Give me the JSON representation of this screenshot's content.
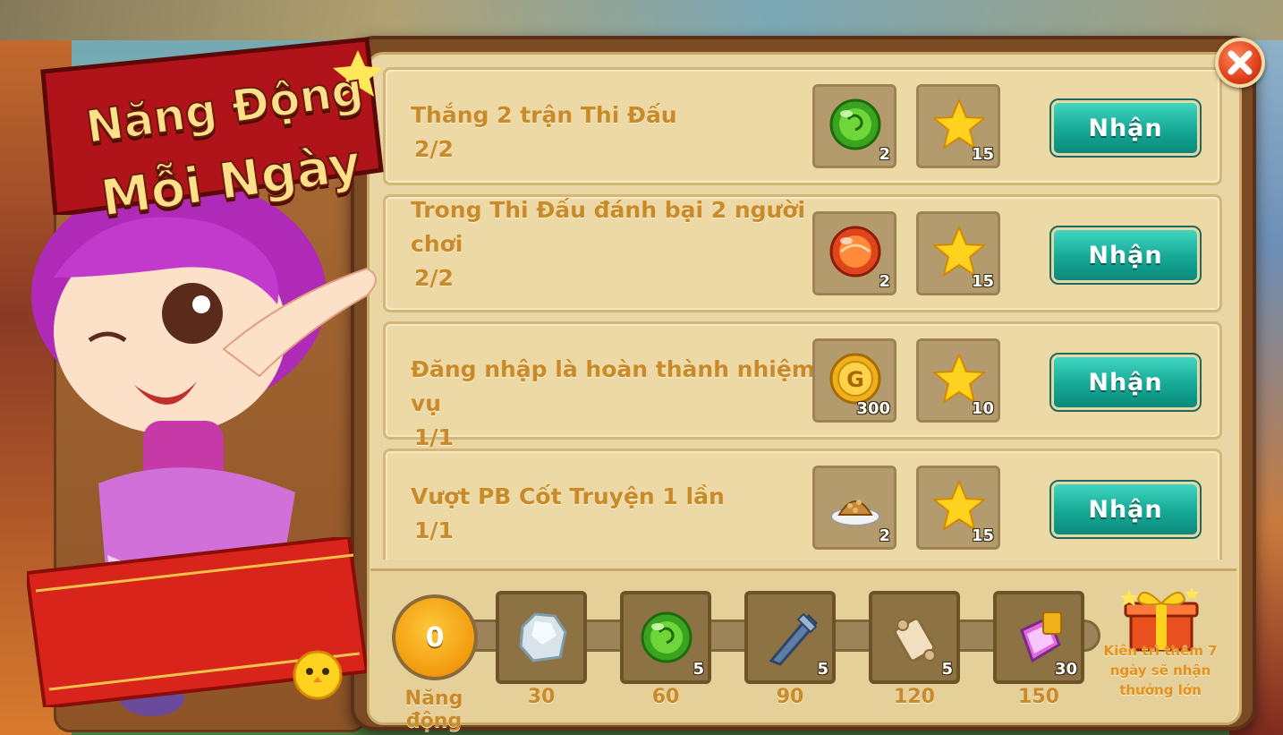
{
  "title": {
    "line1": "Năng Động",
    "line2": "Mỗi Ngày"
  },
  "tasks": [
    {
      "text": "Thắng 2 trận Thi Đấu",
      "progress": "2/2",
      "rewards": [
        {
          "icon": "green-orb-icon",
          "count": "2"
        },
        {
          "icon": "star-icon",
          "count": "15"
        }
      ],
      "button": "Nhận"
    },
    {
      "text": "Trong Thi Đấu đánh bại 2 người chơi",
      "progress": "2/2",
      "rewards": [
        {
          "icon": "red-orb-icon",
          "count": "2"
        },
        {
          "icon": "star-icon",
          "count": "15"
        }
      ],
      "button": "Nhận"
    },
    {
      "text": "Đăng nhập là hoàn thành nhiệm vụ",
      "progress": "1/1",
      "rewards": [
        {
          "icon": "gold-coin-icon",
          "count": "300"
        },
        {
          "icon": "star-icon",
          "count": "10"
        }
      ],
      "button": "Nhận"
    },
    {
      "text": "Vượt PB Cốt Truyện 1 lần",
      "progress": "1/1",
      "rewards": [
        {
          "icon": "food-plate-icon",
          "count": "2"
        },
        {
          "icon": "star-icon",
          "count": "15"
        }
      ],
      "button": "Nhận"
    }
  ],
  "energy": {
    "value": "0",
    "label": "Năng động"
  },
  "milestones": [
    {
      "icon": "ore-rock-icon",
      "count": "",
      "threshold": "30"
    },
    {
      "icon": "green-orb-icon",
      "count": "5",
      "threshold": "60"
    },
    {
      "icon": "drill-cone-icon",
      "count": "5",
      "threshold": "90"
    },
    {
      "icon": "scroll-icon",
      "count": "5",
      "threshold": "120"
    },
    {
      "icon": "crystal-box-icon",
      "count": "30",
      "threshold": "150"
    }
  ],
  "bonus": {
    "text": "Kiên trì thêm 7 ngày sẽ nhận thưởng lớn",
    "icon": "gift-box-icon"
  },
  "colors": {
    "button": "#16a896",
    "task_text": "#c98a2a",
    "panel": "#e9d6a4",
    "energy": "#f29b0e"
  }
}
